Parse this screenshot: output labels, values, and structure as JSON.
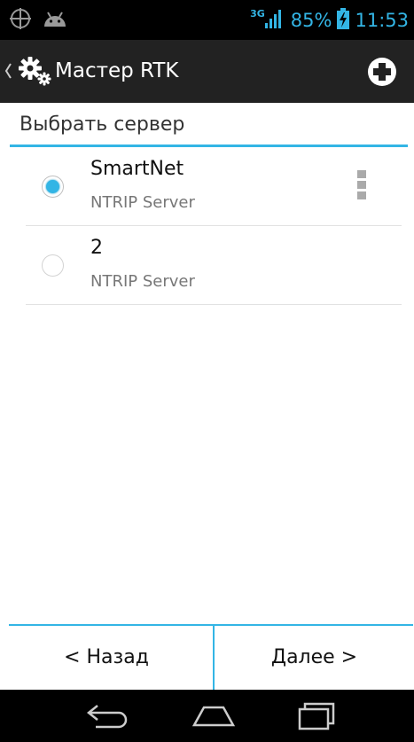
{
  "status_bar": {
    "network_type": "3G",
    "battery_level": "85%",
    "time": "11:53"
  },
  "action_bar": {
    "title": "Мастер RTK"
  },
  "section": {
    "title": "Выбрать сервер"
  },
  "servers": [
    {
      "name": "SmartNet",
      "type": "NTRIP Server",
      "selected": true
    },
    {
      "name": "2",
      "type": "NTRIP Server",
      "selected": false
    }
  ],
  "footer": {
    "back_label": "< Назад",
    "next_label": "Далее >"
  },
  "colors": {
    "accent": "#33b5e5",
    "action_bar": "#222222",
    "status_bar": "#000000"
  },
  "icons": {
    "status_left": [
      "gps-crosshair-icon",
      "android-icon"
    ],
    "status_right": [
      "signal-icon",
      "battery-charging-icon"
    ],
    "action": [
      "back-chevron-icon",
      "gears-icon",
      "add-circle-icon"
    ],
    "system_nav": [
      "back-arrow-icon",
      "home-icon",
      "recent-apps-icon"
    ]
  }
}
